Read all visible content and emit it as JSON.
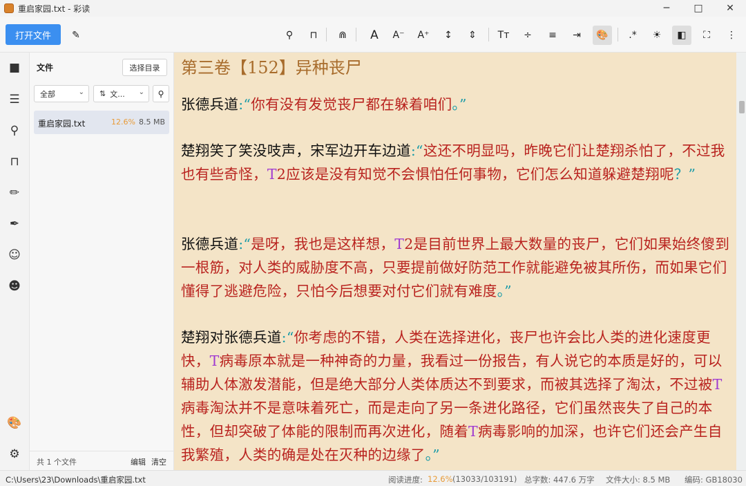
{
  "window": {
    "title": "重启家园.txt - 彩读",
    "controls": [
      "─",
      "□",
      "✕"
    ]
  },
  "toolbar": {
    "open_label": "打开文件"
  },
  "filepanel": {
    "title": "文件",
    "select_dir": "选择目录",
    "filter_all": "全部",
    "sort_label": "文...",
    "file": {
      "name": "重启家园.txt",
      "progress": "12.6%",
      "size": "8.5 MB"
    },
    "count": "共 1 个文件",
    "edit": "编辑",
    "clear": "清空"
  },
  "reader": {
    "chapter_title": "第三卷【152】异种丧尸",
    "p1": {
      "speaker": "张德兵道",
      "colon": ":",
      "oq": "“",
      "text": "你有没有发觉丧尸都在躲着咱们",
      "end": "。”"
    },
    "p2": {
      "speaker": "楚翔笑了笑没吱声，宋军边开车边道",
      "colon": ":",
      "oq": "“",
      "t1": "这还不明显吗，昨晚它们让楚翔杀怕了，不过我也有些奇怪，",
      "tv": "T",
      "t2": "2应该是没有知觉不会惧怕任何事物，它们怎么知道躲避楚翔呢",
      "end": "？”"
    },
    "p3": {
      "speaker": "张德兵道",
      "colon": ":",
      "oq": "“",
      "t1": "是呀，我也是这样想，",
      "tv": "T",
      "t2": "2是目前世界上最大数量的丧尸，它们如果始终傻到一根筋，对人类的威胁度不高，只要提前做好防范工作就能避免被其所伤，而如果它们懂得了逃避危险，只怕今后想要对付它们就有难度",
      "end": "。”"
    },
    "p4": {
      "speaker": "楚翔对张德兵道",
      "colon": ":",
      "oq": "“",
      "t1": "你考虑的不错，人类在选择进化，丧尸也许会比人类的进化速度更快，",
      "tv1": "T",
      "t2": "病毒原本就是一种神奇的力量，我看过一份报告，有人说它的本质是好的，可以辅助人体激发潜能，但是绝大部分人类体质达不到要求，而被其选择了淘汰，不过被",
      "tv2": "T",
      "t3": "病毒淘汰并不是意味着死亡，而是走向了另一条进化路径，它们虽然丧失了自己的本性，但却突破了体能的限制而再次进化，随着",
      "tv3": "T",
      "t4": "病毒影响的加深，也许它们还会产生自我繁殖，人类的确是处在灭种的边缘了",
      "end": "。”"
    }
  },
  "status": {
    "path": "C:\\Users\\23\\Downloads\\重启家园.txt",
    "progress_label": "阅读进度:",
    "progress_pct": "12.6%",
    "progress_detail": "(13033/103191)",
    "words": "总字数: 447.6 万字",
    "filesize": "文件大小: 8.5 MB",
    "encoding": "编码: GB18030"
  },
  "colors": {
    "accent": "#3b8ff0",
    "paper": "#f4e4c7",
    "quote": "#1b9ba8",
    "text": "#b9231f",
    "tvirus": "#a03bd0",
    "chapter": "#a86c2c"
  }
}
